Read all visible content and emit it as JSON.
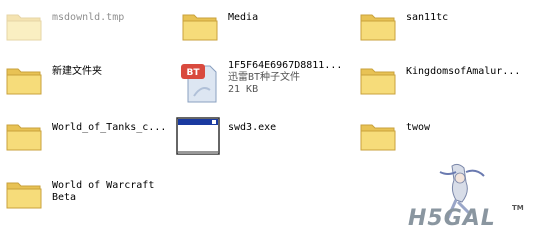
{
  "items": [
    {
      "name": "msdownld.tmp",
      "type": "folder",
      "faded": true
    },
    {
      "name": "Media",
      "type": "folder"
    },
    {
      "name": "san11tc",
      "type": "folder"
    },
    {
      "name": "新建文件夹",
      "type": "folder"
    },
    {
      "name": "1F5F64E6967D8811...",
      "type": "torrent",
      "desc": "迅雷BT种子文件",
      "size": "21 KB",
      "badge": "BT"
    },
    {
      "name": "KingdomsofAmalur...",
      "type": "folder"
    },
    {
      "name": "World_of_Tanks_c...",
      "type": "folder"
    },
    {
      "name": "swd3.exe",
      "type": "exe"
    },
    {
      "name": "twow",
      "type": "folder"
    },
    {
      "name": "World of Warcraft",
      "name2": "Beta",
      "type": "folder"
    }
  ],
  "watermark": {
    "text": "H5GAL",
    "tm": "TM"
  },
  "colors": {
    "folder_front": "#f6dc7a",
    "folder_back": "#e8c254",
    "folder_edge": "#c9a23c",
    "bt_red": "#d94a3e"
  }
}
